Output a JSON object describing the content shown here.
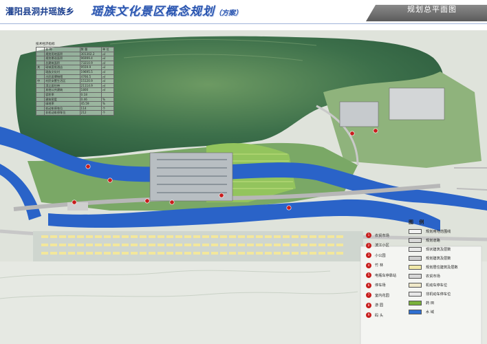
{
  "header": {
    "location": "灌阳县洞井瑶族乡",
    "title": "瑶族文化景区概念规划",
    "title_note": "（方案）",
    "banner": "规划总平面图"
  },
  "stats_table": {
    "caption": "技术经济指标",
    "headers": [
      "名 称",
      "数 量",
      "单 位"
    ],
    "rows": [
      {
        "name": "规划用地面积",
        "value": "301302.2",
        "unit": "㎡"
      },
      {
        "name": "规划景观面积",
        "value": "96999.4",
        "unit": "㎡"
      },
      {
        "name": "总建筑面积",
        "value": "73210.9",
        "unit": "㎡"
      },
      {
        "name": "瑶城度假酒店",
        "value": "9559.9",
        "unit": "㎡"
      },
      {
        "name": "瑶族文化村",
        "value": "19695.5",
        "unit": "㎡"
      },
      {
        "name": "古民居博物馆",
        "value": "4766.5",
        "unit": "㎡"
      },
      {
        "name": "村民安置生活区",
        "value": "15120.9",
        "unit": "㎡"
      },
      {
        "name": "滨江居住带",
        "value": "21114.9",
        "unit": "㎡"
      },
      {
        "name": "其他公共建筑",
        "value": "1800",
        "unit": "㎡"
      },
      {
        "name": "容积率",
        "value": "0.18",
        "unit": ""
      },
      {
        "name": "建筑密度",
        "value": "0.46",
        "unit": "%"
      },
      {
        "name": "绿地率",
        "value": "45.59",
        "unit": "%"
      },
      {
        "name": "机动车停车位",
        "value": "114",
        "unit": "个"
      },
      {
        "name": "非机动车停车位",
        "value": "212",
        "unit": "个"
      }
    ],
    "group_labels": [
      "其",
      "中"
    ]
  },
  "legend": {
    "title": "图 例",
    "symbols": [
      {
        "num": "1",
        "label": "农贸市场"
      },
      {
        "num": "2",
        "label": "滨江小区"
      },
      {
        "num": "3",
        "label": "小公园"
      },
      {
        "num": "4",
        "label": "竹 林"
      },
      {
        "num": "5",
        "label": "电瓶车停靠站"
      },
      {
        "num": "6",
        "label": "停车场"
      },
      {
        "num": "7",
        "label": "室内花园"
      },
      {
        "num": "8",
        "label": "游 园"
      },
      {
        "num": "9",
        "label": "码 头"
      }
    ],
    "swatches": [
      {
        "label": "规划用地范围线",
        "color": "#f3f3f3"
      },
      {
        "label": "规划道路",
        "color": "#d9d9d9"
      },
      {
        "label": "现状建筑及层数",
        "color": "#e8e8e8"
      },
      {
        "label": "规划建筑及层数",
        "color": "#cfcfcf"
      },
      {
        "label": "规划居住建筑及层数",
        "color": "#f1e9a9"
      },
      {
        "label": "农贸市场",
        "color": "#d7d7d7"
      },
      {
        "label": "机动车停车位",
        "color": "#efe8c8"
      },
      {
        "label": "非机动车停车位",
        "color": "#e7e7e7"
      },
      {
        "label": "药 田",
        "color": "#79b13a"
      },
      {
        "label": "水 域",
        "color": "#2e6fd1"
      }
    ]
  },
  "colors": {
    "terrain": "#3f7a4f",
    "river": "#2a63c8",
    "green": "#5ba33a",
    "road": "#bdbdbd",
    "marker": "#c81d1d"
  }
}
